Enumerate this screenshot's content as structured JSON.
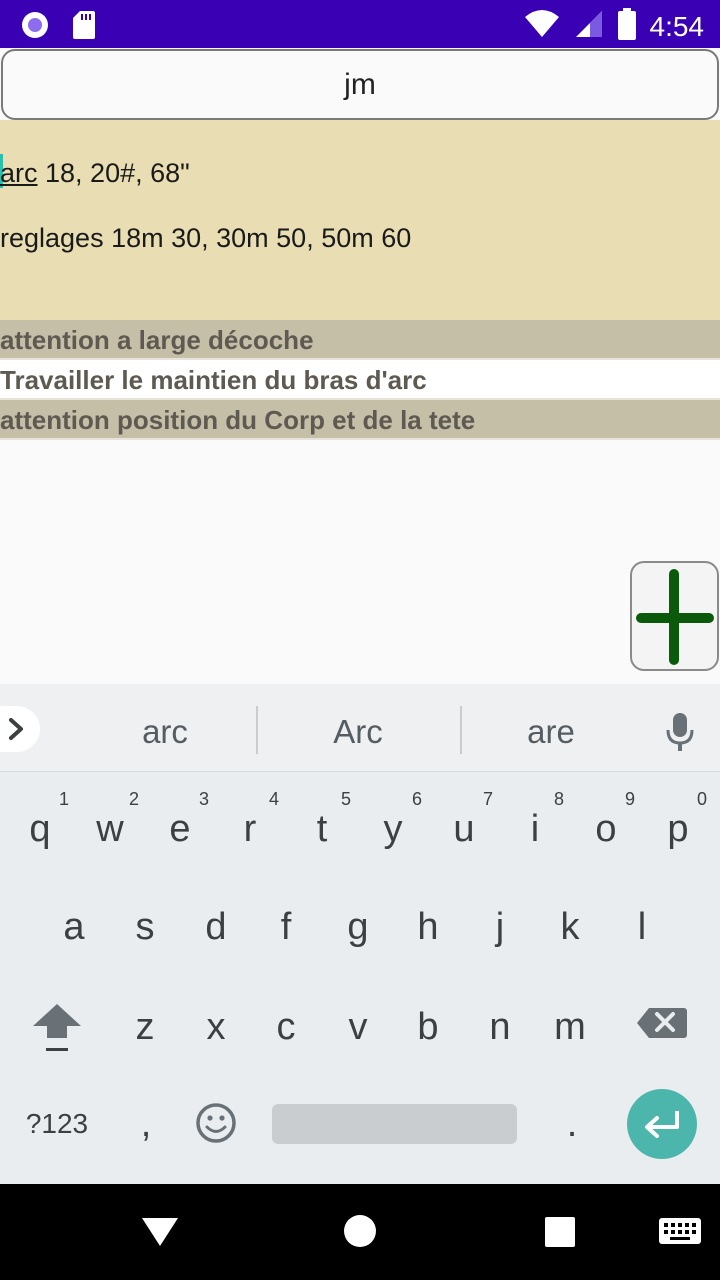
{
  "status_bar": {
    "time": "4:54",
    "icons": [
      "notification-dot-icon",
      "sd-card-icon",
      "wifi-icon",
      "signal-icon",
      "battery-icon"
    ]
  },
  "title_field": {
    "value": "jm"
  },
  "notes": {
    "line1_word": "arc",
    "line1_rest": " 18, 20#, 68\"",
    "line2": "reglages 18m 30, 30m 50, 50m 60"
  },
  "list_items": [
    "attention a large décoche",
    "Travailler le maintien du bras d'arc",
    "attention position du Corp et de la tete"
  ],
  "add_button": {
    "icon": "plus-icon",
    "color": "#0b5a0b"
  },
  "keyboard": {
    "suggestions": [
      "arc",
      "Arc",
      "are"
    ],
    "row1": [
      "q",
      "w",
      "e",
      "r",
      "t",
      "y",
      "u",
      "i",
      "o",
      "p"
    ],
    "row1_hints": [
      "1",
      "2",
      "3",
      "4",
      "5",
      "6",
      "7",
      "8",
      "9",
      "0"
    ],
    "row2": [
      "a",
      "s",
      "d",
      "f",
      "g",
      "h",
      "j",
      "k",
      "l"
    ],
    "row3": [
      "z",
      "x",
      "c",
      "v",
      "b",
      "n",
      "m"
    ],
    "symbols_label": "?123",
    "comma": ",",
    "period": "."
  },
  "colors": {
    "status_bar": "#3a00b4",
    "notes_bg": "#e8ddb3",
    "list_shade": "#c6bfa8",
    "enter_key": "#4db6ac"
  }
}
